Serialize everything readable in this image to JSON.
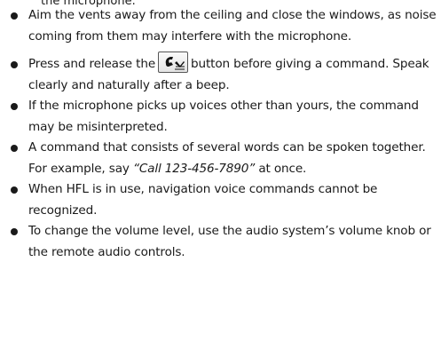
{
  "cut_text": "the microphone.",
  "bullets": [
    {
      "text": "Aim the vents away from the ceiling and close the windows, as noise coming from them may interfere with the microphone."
    },
    {
      "before": "Press and release the",
      "icon": "talk-button-icon",
      "after": "button before giving a command. Speak clearly and naturally after a beep."
    },
    {
      "text": "If the microphone picks up voices other than yours, the command may be misinterpreted."
    },
    {
      "before": "A command that consists of several words can be spoken together. For example, say",
      "quote": "“Call 123-456-7890”",
      "after": "at once."
    },
    {
      "text": "When HFL is in use, navigation voice commands cannot be recognized."
    },
    {
      "text": "To change the volume level, use the audio system’s volume knob or the remote audio controls."
    }
  ]
}
